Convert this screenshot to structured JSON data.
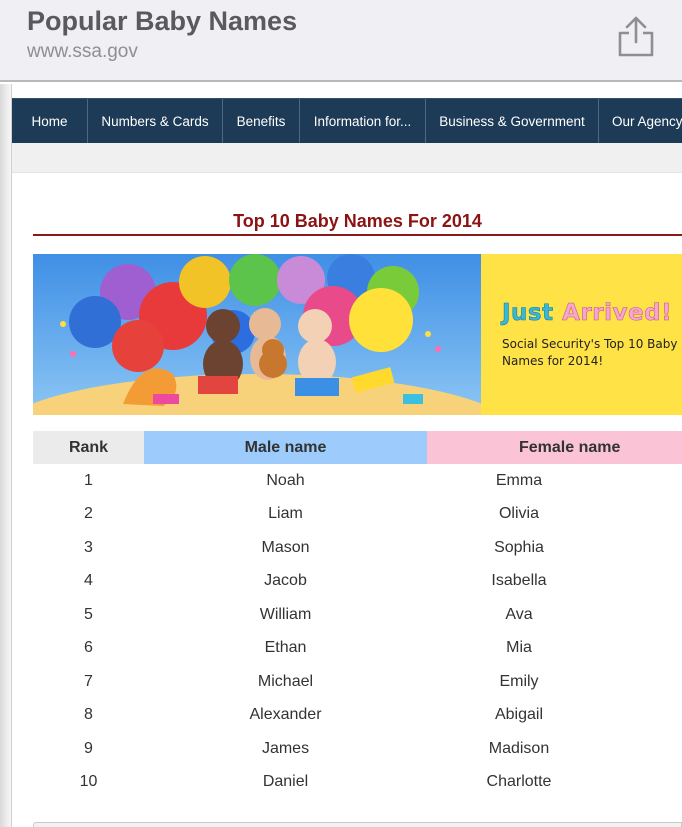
{
  "browser": {
    "title": "Popular Baby Names",
    "url": "www.ssa.gov",
    "share_icon": "share-icon"
  },
  "nav": {
    "items": [
      {
        "label": "Home"
      },
      {
        "label": "Numbers & Cards"
      },
      {
        "label": "Benefits"
      },
      {
        "label": "Information for..."
      },
      {
        "label": "Business & Government"
      },
      {
        "label": "Our Agency"
      }
    ]
  },
  "content": {
    "heading": "Top 10 Baby Names For 2014",
    "banner": {
      "headline_part1": "Just",
      "headline_part2": "Arrived!",
      "subtext": "Social Security's Top 10 Baby Names for 2014!"
    }
  },
  "table": {
    "headers": {
      "rank": "Rank",
      "male": "Male name",
      "female": "Female name"
    },
    "rows": [
      {
        "rank": "1",
        "male": "Noah",
        "female": "Emma"
      },
      {
        "rank": "2",
        "male": "Liam",
        "female": "Olivia"
      },
      {
        "rank": "3",
        "male": "Mason",
        "female": "Sophia"
      },
      {
        "rank": "4",
        "male": "Jacob",
        "female": "Isabella"
      },
      {
        "rank": "5",
        "male": "William",
        "female": "Ava"
      },
      {
        "rank": "6",
        "male": "Ethan",
        "female": "Mia"
      },
      {
        "rank": "7",
        "male": "Michael",
        "female": "Emily"
      },
      {
        "rank": "8",
        "male": "Alexander",
        "female": "Abigail"
      },
      {
        "rank": "9",
        "male": "James",
        "female": "Madison"
      },
      {
        "rank": "10",
        "male": "Daniel",
        "female": "Charlotte"
      }
    ]
  },
  "colors": {
    "nav_bg": "#1d3a57",
    "heading": "#8b1313",
    "male_header": "#9dcbfb",
    "female_header": "#fac4d6",
    "promo_bg": "#ffe346"
  }
}
